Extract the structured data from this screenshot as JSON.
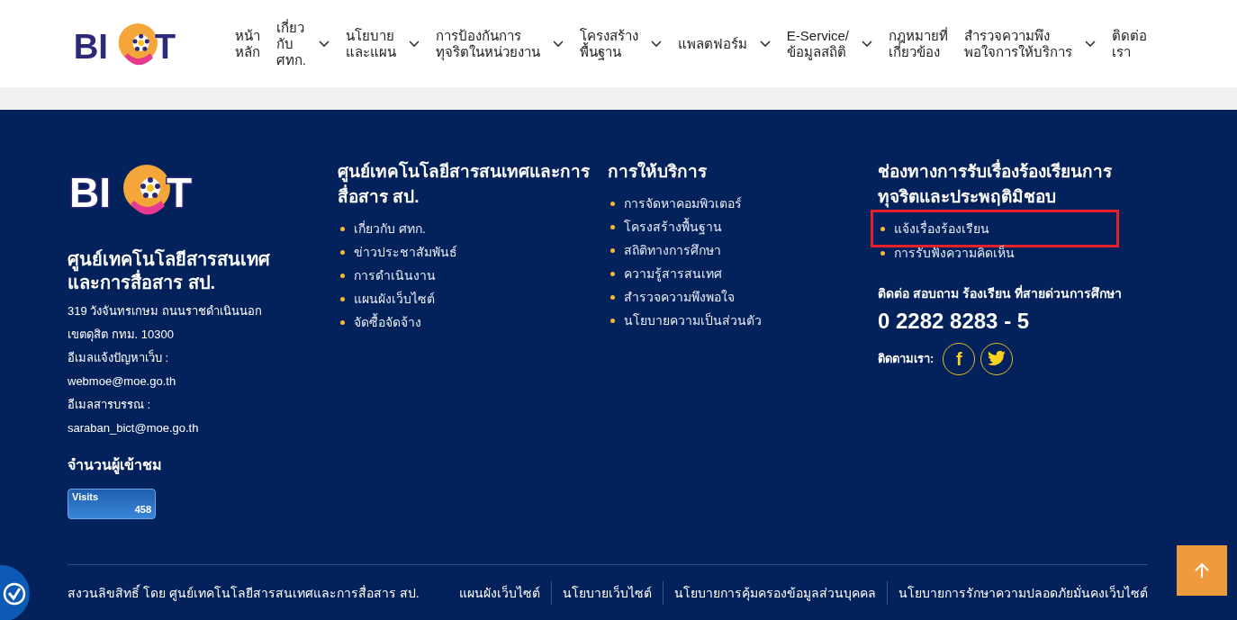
{
  "header": {
    "logo": {
      "left": "BI",
      "right": "T"
    },
    "nav": [
      {
        "lines": [
          "หน้า",
          "หลัก"
        ],
        "dropdown": false
      },
      {
        "lines": [
          "เกี่ยว",
          "กับ",
          "ศทก."
        ],
        "dropdown": true
      },
      {
        "lines": [
          "นโยบาย",
          "และแผน"
        ],
        "dropdown": true
      },
      {
        "lines": [
          "การป้องกันการ",
          "ทุจริตในหน่วยงาน"
        ],
        "dropdown": true
      },
      {
        "lines": [
          "โครงสร้าง",
          "พื้นฐาน"
        ],
        "dropdown": true
      },
      {
        "lines": [
          "แพลตฟอร์ม"
        ],
        "dropdown": true
      },
      {
        "lines": [
          "E-Service/",
          "ข้อมูลสถิติ"
        ],
        "dropdown": true
      },
      {
        "lines": [
          "กฎหมายที่",
          "เกี่ยวข้อง"
        ],
        "dropdown": false
      },
      {
        "lines": [
          "สำรวจความพึง",
          "พอใจการให้บริการ"
        ],
        "dropdown": true
      },
      {
        "lines": [
          "ติดต่อ",
          "เรา"
        ],
        "dropdown": false
      }
    ]
  },
  "footer": {
    "about": {
      "logo": {
        "left": "BI",
        "right": "T"
      },
      "name_lines": [
        "ศูนย์เทคโนโลยีสารสนเทศ",
        "และการสื่อสาร สป."
      ],
      "info": [
        "319 วังจันทรเกษม ถนนราชดำเนินนอก",
        "เขตดุสิต กทม. 10300",
        "อีเมลแจ้งปัญหาเว็บ :",
        "webmoe@moe.go.th",
        "อีเมลสารบรรณ :",
        "saraban_bict@moe.go.th"
      ],
      "visitors_title": "จำนวนผู้เข้าชม",
      "counter": {
        "label": "Visits",
        "value": "458"
      }
    },
    "columns": [
      {
        "title_lines": [
          "ศูนย์เทคโนโลยีสารสนเทศและการ",
          "สื่อสาร สป."
        ],
        "links": [
          {
            "text": "เกี่ยวกับ ศทก.",
            "highlighted": false
          },
          {
            "text": "ข่าวประชาสัมพันธ์",
            "highlighted": false
          },
          {
            "text": "การดำเนินงาน",
            "highlighted": false
          },
          {
            "text": "แผนผังเว็บไซต์",
            "highlighted": false
          },
          {
            "text": "จัดซื้อจัดจ้าง",
            "highlighted": false
          }
        ]
      },
      {
        "title_lines": [
          "การให้บริการ"
        ],
        "links": [
          {
            "text": "การจัดหาคอมพิวเตอร์",
            "highlighted": false
          },
          {
            "text": "โครงสร้างพื้นฐาน",
            "highlighted": false
          },
          {
            "text": "สถิติทางการศึกษา",
            "highlighted": false
          },
          {
            "text": "ความรู้สารสนเทศ",
            "highlighted": false
          },
          {
            "text": "สำรวจความพึงพอใจ",
            "highlighted": false
          },
          {
            "text": "นโยบายความเป็นส่วนตัว",
            "highlighted": false
          }
        ]
      },
      {
        "title_lines": [
          "ช่องทางการรับเรื่องร้องเรียนการ",
          "ทุจริตและประพฤติมิชอบ"
        ],
        "links": [
          {
            "text": "แจ้งเรื่องร้องเรียน",
            "highlighted": true
          },
          {
            "text": "การรับฟังความคิดเห็น",
            "highlighted": false
          }
        ]
      }
    ],
    "contact": {
      "title": "ติดต่อ สอบถาม ร้องเรียน ที่สายด่วนการศึกษา",
      "phone": "0 2282 8283 - 5",
      "follow_label": "ติดตามเรา:",
      "social": [
        {
          "kind": "facebook",
          "glyph": "f"
        },
        {
          "kind": "twitter"
        }
      ]
    },
    "copyright": "สงวนลิขสิทธิ์ โดย ศูนย์เทคโนโลยีสารสนเทศและการสื่อสาร สป.",
    "bottom_links": [
      "แผนผังเว็บไซต์",
      "นโยบายเว็บไซต์",
      "นโยบายการคุ้มครองข้อมูลส่วนบุคคล",
      "นโยบายการรักษาความปลอดภัยมั่นคงเว็บไซต์"
    ]
  }
}
